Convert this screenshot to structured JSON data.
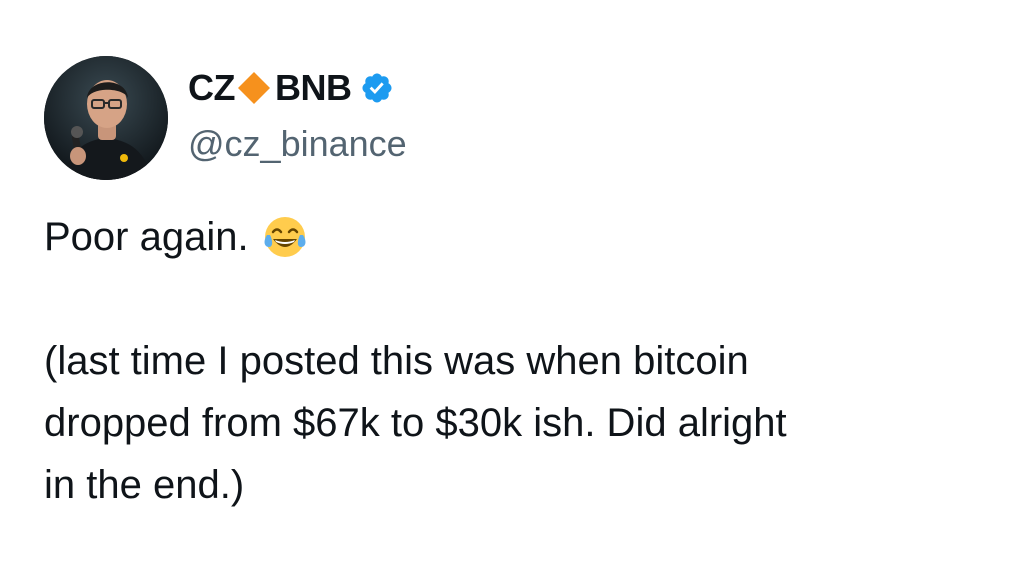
{
  "tweet": {
    "author": {
      "name_part1": "CZ",
      "name_part2": "BNB",
      "handle": "@cz_binance",
      "verified": true,
      "name_emoji": "orange-diamond-icon",
      "avatar": "avatar-photo"
    },
    "text": {
      "line1": "Poor again.",
      "line1_emoji": "face-with-tears-of-joy-icon",
      "para2_lines": [
        "(last time I posted this was when bitcoin",
        "dropped from $67k to $30k ish. Did alright",
        "in the end.)"
      ]
    }
  },
  "colors": {
    "text_primary": "#0f1419",
    "text_secondary": "#536471",
    "verified_blue": "#1d9bf0",
    "bnb_orange": "#f6911d",
    "background": "#ffffff"
  }
}
